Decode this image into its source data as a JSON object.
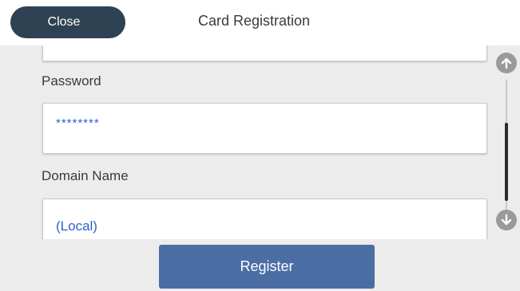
{
  "header": {
    "close_label": "Close",
    "title": "Card Registration"
  },
  "form": {
    "fields": [
      {
        "label": "Password",
        "value": "********"
      },
      {
        "label": "Domain Name",
        "value": "(Local)"
      }
    ]
  },
  "scrollbar": {
    "up_icon": "arrow-up-icon",
    "down_icon": "arrow-down-icon"
  },
  "footer": {
    "register_label": "Register"
  },
  "colors": {
    "header_button": "#2f4254",
    "register_button": "#4a6ea3",
    "value_text": "#2b63c9",
    "scroll_button": "#9a9a9a",
    "background": "#ececec"
  }
}
